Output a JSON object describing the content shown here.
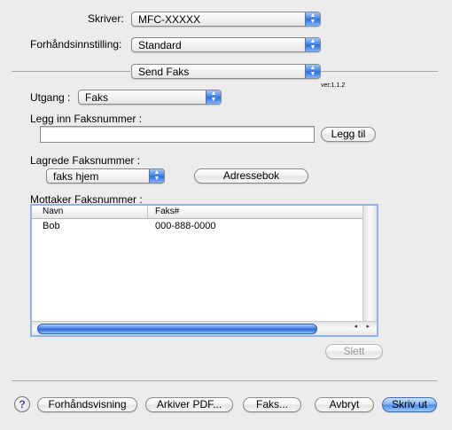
{
  "top": {
    "printer_label": "Skriver:",
    "printer_value": "MFC-XXXXX",
    "preset_label": "Forhåndsinnstilling:",
    "preset_value": "Standard",
    "pane_value": "Send Faks"
  },
  "version": "ver:1.1.2",
  "output": {
    "label": "Utgang :",
    "value": "Faks"
  },
  "fax_entry": {
    "label": "Legg inn Faksnummer :",
    "value": "",
    "add_button": "Legg til"
  },
  "stored": {
    "label": "Lagrede Faksnummer :",
    "value": "faks hjem",
    "address_book_button": "Adressebok"
  },
  "recipients": {
    "label": "Mottaker Faksnummer :",
    "columns": [
      "Navn",
      "Faks#"
    ],
    "rows": [
      {
        "name": "Bob",
        "fax": "000-888-0000"
      }
    ],
    "scroll_left": "◂",
    "scroll_right": "▸"
  },
  "delete_button": "Slett",
  "footer": {
    "help": "?",
    "preview": "Forhåndsvisning",
    "archive_pdf": "Arkiver PDF...",
    "fax": "Faks...",
    "cancel": "Avbryt",
    "print": "Skriv ut"
  },
  "popup_arrows": {
    "up": "▲",
    "down": "▼"
  },
  "colors": {
    "accent": "#3c7fe6",
    "table_border": "#8fb3e6"
  }
}
